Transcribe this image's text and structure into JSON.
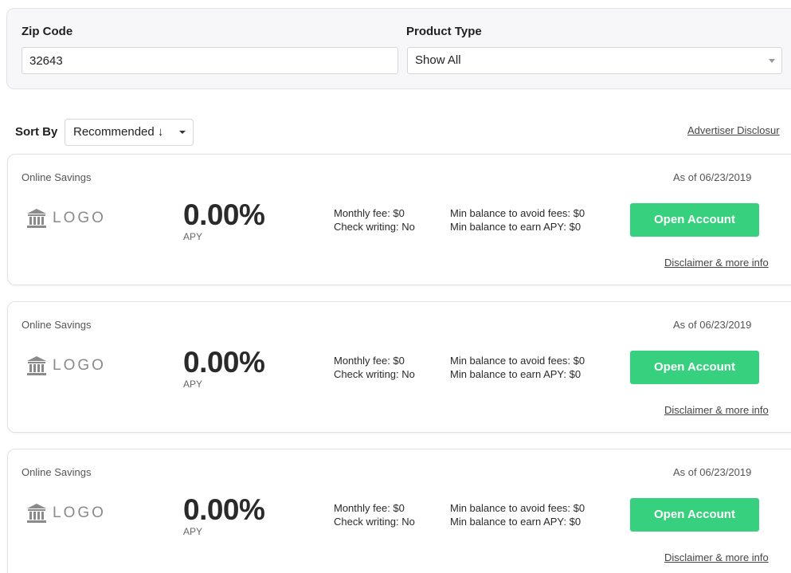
{
  "filters": {
    "zip_label": "Zip Code",
    "zip_value": "32643",
    "product_type_label": "Product Type",
    "product_type_value": "Show All"
  },
  "sort": {
    "label": "Sort By",
    "value": "Recommended ↓"
  },
  "advertiser_disclosure": "Advertiser Disclosur",
  "offers": [
    {
      "product_type": "Online Savings",
      "as_of": "As of 06/23/2019",
      "logo_text": "LOGO",
      "rate": "0.00%",
      "rate_label": "APY",
      "monthly_fee": "Monthly fee: $0",
      "check_writing": "Check writing: No",
      "min_avoid_fees": "Min balance to avoid fees: $0",
      "min_earn_apy": "Min balance to earn APY: $0",
      "cta": "Open Account",
      "disclaimer": "Disclaimer & more info"
    },
    {
      "product_type": "Online Savings",
      "as_of": "As of 06/23/2019",
      "logo_text": "LOGO",
      "rate": "0.00%",
      "rate_label": "APY",
      "monthly_fee": "Monthly fee: $0",
      "check_writing": "Check writing: No",
      "min_avoid_fees": "Min balance to avoid fees: $0",
      "min_earn_apy": "Min balance to earn APY: $0",
      "cta": "Open Account",
      "disclaimer": "Disclaimer & more info"
    },
    {
      "product_type": "Online Savings",
      "as_of": "As of 06/23/2019",
      "logo_text": "LOGO",
      "rate": "0.00%",
      "rate_label": "APY",
      "monthly_fee": "Monthly fee: $0",
      "check_writing": "Check writing: No",
      "min_avoid_fees": "Min balance to avoid fees: $0",
      "min_earn_apy": "Min balance to earn APY: $0",
      "cta": "Open Account",
      "disclaimer": "Disclaimer & more info"
    }
  ],
  "colors": {
    "cta_green": "#37d07e",
    "panel_bg": "#f7f7f9",
    "logo_gray": "#8a8a8a"
  },
  "icons": {
    "bank": "bank-icon",
    "select_caret": "chevron-down-icon"
  }
}
